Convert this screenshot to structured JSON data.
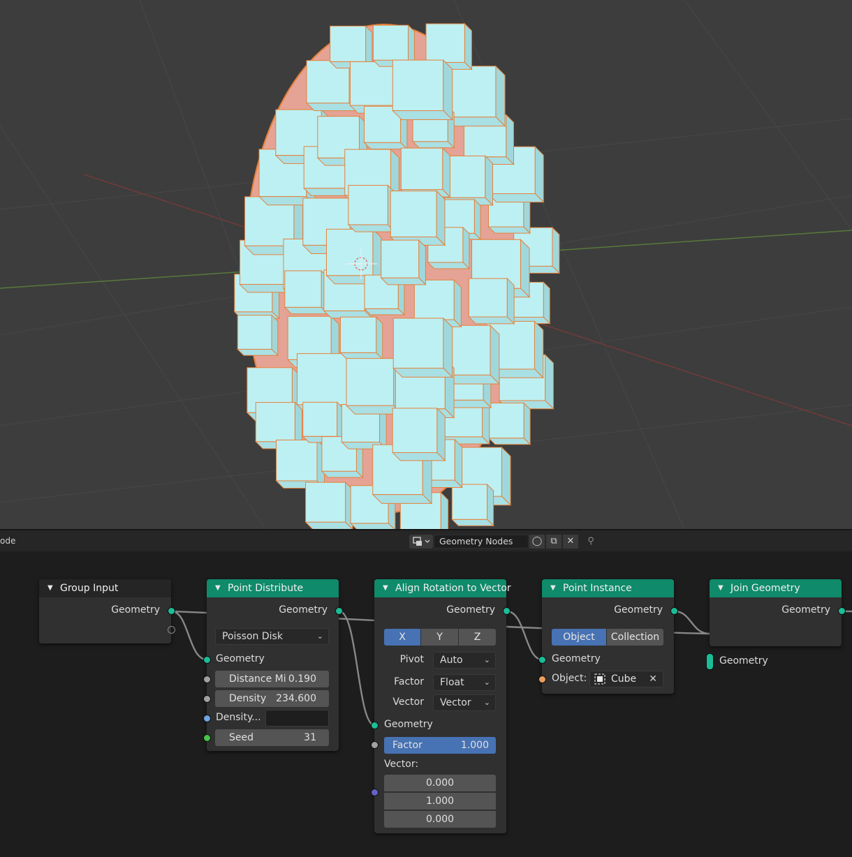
{
  "header": {
    "mode_text": "ode",
    "node_tree_name": "Geometry Nodes"
  },
  "nodes": {
    "group_input": {
      "title": "Group Input",
      "output": "Geometry"
    },
    "point_distribute": {
      "title": "Point Distribute",
      "output": "Geometry",
      "method": "Poisson Disk",
      "input_geometry": "Geometry",
      "distance_label": "Distance Mi",
      "distance_value": "0.190",
      "density_label": "Density",
      "density_value": "234.600",
      "density_attr_label": "Density...",
      "seed_label": "Seed",
      "seed_value": "31"
    },
    "align_rotation": {
      "title": "Align Rotation to Vector",
      "output": "Geometry",
      "axes": [
        "X",
        "Y",
        "Z"
      ],
      "pivot_label": "Pivot",
      "pivot_value": "Auto",
      "factor_label": "Factor",
      "factor_type": "Float",
      "vector_label": "Vector",
      "vector_type": "Vector",
      "input_geometry": "Geometry",
      "factor_field_label": "Factor",
      "factor_field_value": "1.000",
      "vector_heading": "Vector:",
      "vector_values": [
        "0.000",
        "1.000",
        "0.000"
      ]
    },
    "point_instance": {
      "title": "Point Instance",
      "output": "Geometry",
      "type_object": "Object",
      "type_collection": "Collection",
      "input_geometry": "Geometry",
      "object_label": "Object:",
      "object_value": "Cube"
    },
    "join_geometry": {
      "title": "Join Geometry",
      "output": "Geometry",
      "input": "Geometry"
    }
  },
  "colors": {
    "node_header": "#0f8a6a",
    "geometry_socket": "#1bbd96",
    "selected_field": "#4772b3",
    "cube_face": "#bdf0f2",
    "inner_mesh": "#e4a395",
    "selection_outline": "#e6813a"
  }
}
